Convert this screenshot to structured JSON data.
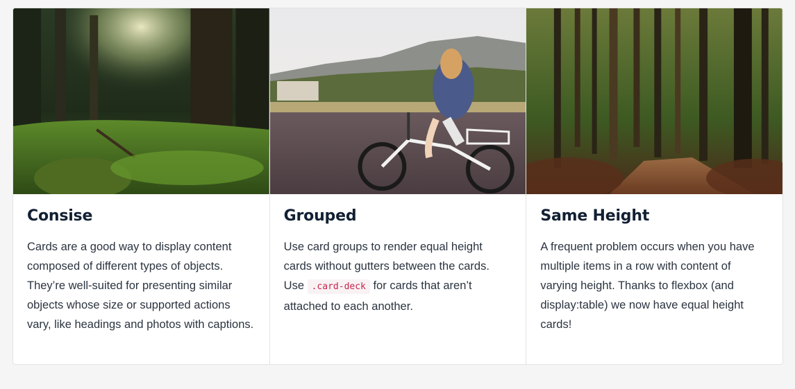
{
  "cards": [
    {
      "title": "Consise",
      "text": "Cards are a good way to display content composed of different types of objects. They’re well-suited for presenting similar objects whose size or supported actions vary, like headings and photos with captions."
    },
    {
      "title": "Grouped",
      "text_before": "Use card groups to render equal height cards without gutters between the cards. Use ",
      "code": ".card-deck",
      "text_after": " for cards that aren’t attached to each another."
    },
    {
      "title": "Same Height",
      "text": "A frequent problem occurs when you have multiple items in a row with content of varying height. Thanks to flexbox (and display:table) we now have equal height cards!"
    }
  ],
  "colors": {
    "page_background": "#f5f5f5",
    "card_background": "#ffffff",
    "title": "#122033",
    "body_text": "#2b3440",
    "code_text": "#c7254e",
    "code_background": "#f9f2f4"
  },
  "images": [
    "forest-grass-photo",
    "girl-on-bicycle-photo",
    "forest-path-photo"
  ]
}
